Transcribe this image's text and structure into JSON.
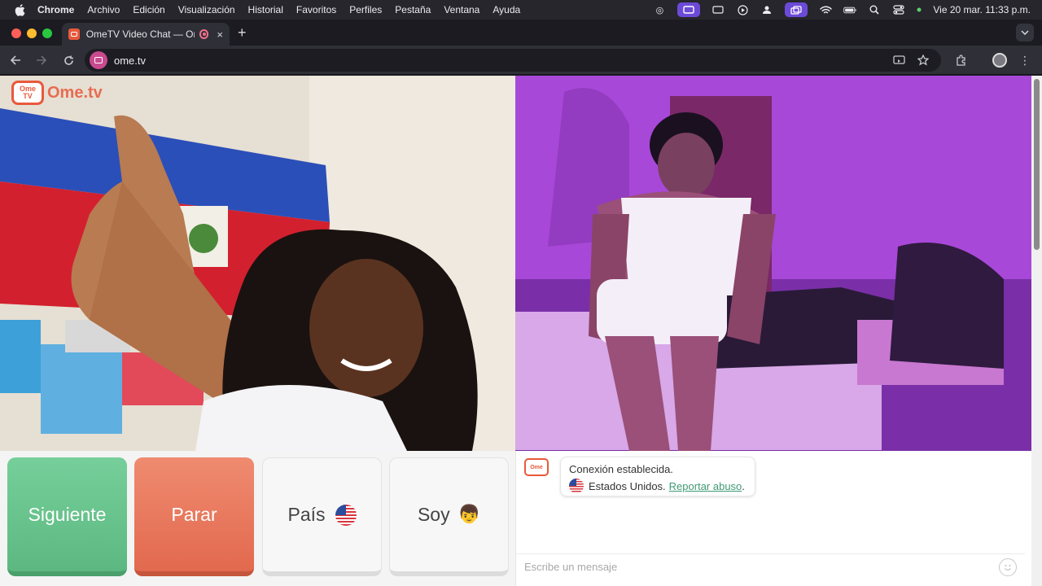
{
  "menubar": {
    "app": "Chrome",
    "items": [
      "Archivo",
      "Edición",
      "Visualización",
      "Historial",
      "Favoritos",
      "Perfiles",
      "Pestaña",
      "Ventana",
      "Ayuda"
    ],
    "clock": "Vie 20 mar.  11:33 p.m."
  },
  "browser": {
    "tab_title": "OmeTV Video Chat — Ome",
    "tab_close": "×",
    "new_tab": "+",
    "url": "ome.tv"
  },
  "brand": {
    "logo_badge_line1": "Ome",
    "logo_badge_line2": "TV",
    "logo_text": "Ome.tv",
    "accent": "#e8593c"
  },
  "controls": {
    "next_label": "Siguiente",
    "stop_label": "Parar",
    "country_label": "País",
    "gender_label": "Soy",
    "next_color": "#5cb880",
    "stop_color": "#e2694e"
  },
  "chat": {
    "status_line": "Conexión establecida.",
    "country_text": "Estados Unidos.",
    "report_link": "Reportar abuso",
    "report_suffix": ".",
    "input_placeholder": "Escribe un mensaje",
    "link_color": "#3f9a74"
  }
}
